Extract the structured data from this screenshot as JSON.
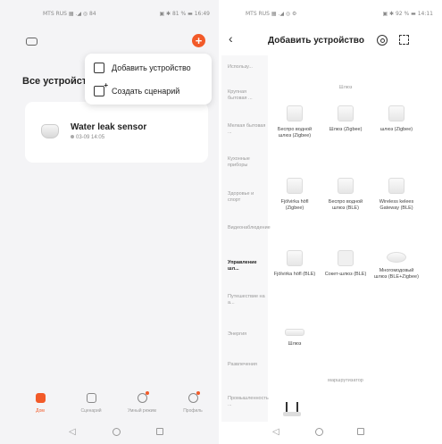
{
  "left": {
    "status": {
      "left": "MTS RUS ▦ .◢ ◎ 84",
      "right": "▣ ✱ 81 % ▬ 16:49"
    },
    "home_title": "Все устройства",
    "menu": {
      "add_device": "Добавить устройство",
      "create_scene": "Создать сценарий"
    },
    "device": {
      "name": "Water leak sensor",
      "date": "03-09 14:05"
    },
    "tabs": [
      {
        "label": "Дом"
      },
      {
        "label": "Сценарий"
      },
      {
        "label": "Умный режим"
      },
      {
        "label": "Профиль"
      }
    ],
    "nav": {
      "back": "◁"
    }
  },
  "right": {
    "status": {
      "left": "MTS RUS ▦ .◢ ◎ ⚙",
      "right": "▣ ✱ 92 % ▬ 14:11"
    },
    "back": "‹",
    "title": "Добавить устройство",
    "categories": [
      {
        "label": "Использу..."
      },
      {
        "label": "Крупная бытовая ..."
      },
      {
        "label": "Мелкая бытовая ..."
      },
      {
        "label": "Кухонные приборы"
      },
      {
        "label": "Здоровье и спорт"
      },
      {
        "label": "Видеонаблюдение"
      },
      {
        "label": "Управление шл..."
      },
      {
        "label": "Путешествие на а..."
      },
      {
        "label": "Энергия"
      },
      {
        "label": "Развлечения"
      },
      {
        "label": "Промышленность ..."
      }
    ],
    "sections": {
      "gateways": "Шлюз",
      "router": "маршрутизатор"
    },
    "devices": [
      {
        "label": "Беспро водной шлюз (Zigbee)"
      },
      {
        "label": "Шлюз (Zigbee)"
      },
      {
        "label": "шлюз (Zigbee)"
      },
      {
        "label": "Fjölvirka höfl (Zigbee)"
      },
      {
        "label": "Беспро водной шлюз (BLE)"
      },
      {
        "label": "Wireless kelees Gateway (BLE)"
      },
      {
        "label": "Fjölvirka höfl (BLE)"
      },
      {
        "label": "Сокет-шлюз (BLE)"
      },
      {
        "label": "Многомодовый шлюз (BLE+Zigbee)"
      },
      {
        "label": "Шлюз"
      }
    ],
    "nav": {
      "back": "◁"
    }
  },
  "colors": {
    "accent": "#f25a29",
    "text": "#222222",
    "muted": "#999999"
  }
}
